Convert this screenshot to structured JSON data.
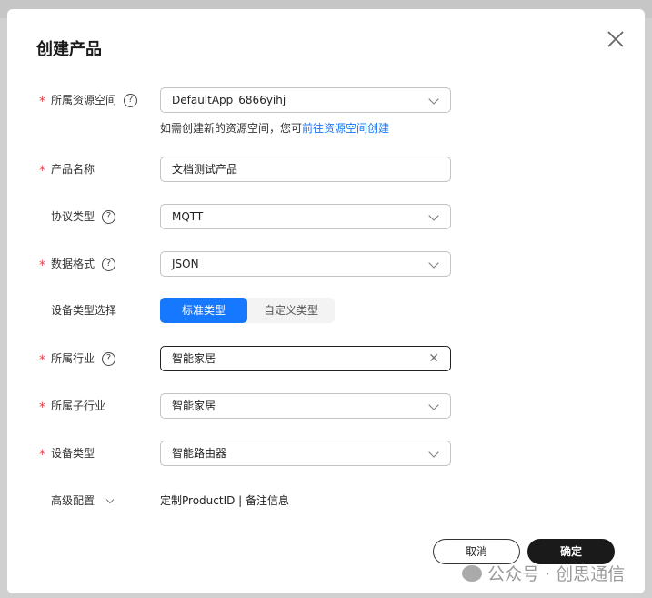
{
  "dialog": {
    "title": "创建产品"
  },
  "fields": {
    "resource_space": {
      "label": "所属资源空间",
      "required": true,
      "value": "DefaultApp_6866yihj",
      "hint": "如需创建新的资源空间，您可",
      "hint_link": "前往资源空间创建"
    },
    "product_name": {
      "label": "产品名称",
      "required": true,
      "value": "文档测试产品"
    },
    "protocol": {
      "label": "协议类型",
      "required": false,
      "value": "MQTT"
    },
    "data_format": {
      "label": "数据格式",
      "required": true,
      "value": "JSON"
    },
    "device_type_select": {
      "label": "设备类型选择",
      "options": [
        "标准类型",
        "自定义类型"
      ],
      "selected": "标准类型"
    },
    "industry": {
      "label": "所属行业",
      "required": true,
      "value": "智能家居"
    },
    "sub_industry": {
      "label": "所属子行业",
      "required": true,
      "value": "智能家居"
    },
    "device_type": {
      "label": "设备类型",
      "required": true,
      "value": "智能路由器"
    },
    "advanced": {
      "label": "高级配置",
      "summary": "定制ProductID | 备注信息"
    }
  },
  "footer": {
    "cancel": "取消",
    "confirm": "确定"
  },
  "watermark": "公众号 · 创思通信",
  "colors": {
    "primary": "#1677ff",
    "required": "#e5404a",
    "confirm_bg": "#1a1a1a"
  }
}
